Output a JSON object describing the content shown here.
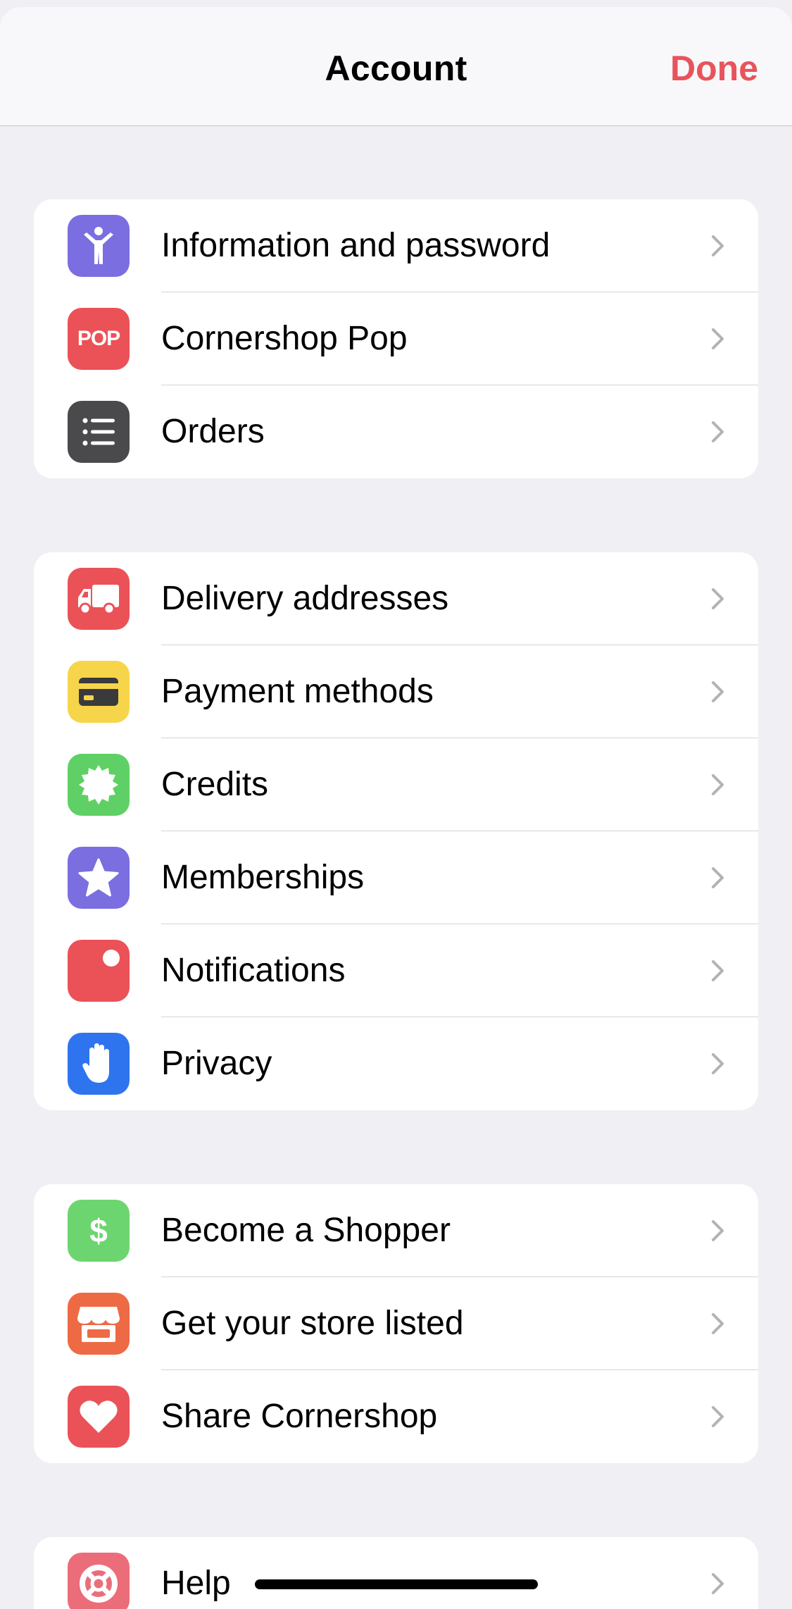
{
  "header": {
    "title": "Account",
    "done_label": "Done"
  },
  "groups": [
    {
      "items": [
        {
          "label": "Information and password",
          "icon": "person-icon",
          "color": "#7a6ee0"
        },
        {
          "label": "Cornershop Pop",
          "icon": "pop-icon",
          "color": "#ea5258",
          "icon_text": "POP"
        },
        {
          "label": "Orders",
          "icon": "list-icon",
          "color": "#4a4a4c"
        }
      ]
    },
    {
      "items": [
        {
          "label": "Delivery addresses",
          "icon": "truck-icon",
          "color": "#ea5258"
        },
        {
          "label": "Payment methods",
          "icon": "credit-card-icon",
          "color": "#f7d54a"
        },
        {
          "label": "Credits",
          "icon": "badge-icon",
          "color": "#5fd065"
        },
        {
          "label": "Memberships",
          "icon": "star-icon",
          "color": "#7a6ee0"
        },
        {
          "label": "Notifications",
          "icon": "notification-icon",
          "color": "#ea5258"
        },
        {
          "label": "Privacy",
          "icon": "hand-icon",
          "color": "#2f74ef"
        }
      ]
    },
    {
      "items": [
        {
          "label": "Become a Shopper",
          "icon": "dollar-icon",
          "color": "#6dd56f",
          "icon_text": "$"
        },
        {
          "label": "Get your store listed",
          "icon": "storefront-icon",
          "color": "#ee6a45"
        },
        {
          "label": "Share Cornershop",
          "icon": "heart-icon",
          "color": "#ea5258"
        }
      ]
    },
    {
      "items": [
        {
          "label": "Help",
          "icon": "lifebuoy-icon",
          "color": "#ec6d7a"
        }
      ]
    }
  ]
}
